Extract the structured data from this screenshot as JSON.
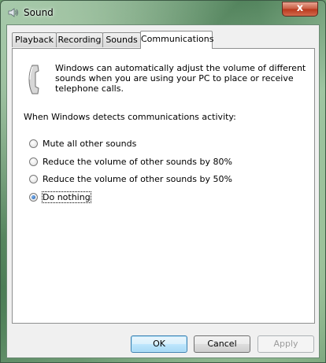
{
  "window": {
    "title": "Sound",
    "close_label": "x"
  },
  "tabs": [
    {
      "label": "Playback",
      "active": false
    },
    {
      "label": "Recording",
      "active": false
    },
    {
      "label": "Sounds",
      "active": false
    },
    {
      "label": "Communications",
      "active": true
    }
  ],
  "communications": {
    "intro": "Windows can automatically adjust the volume of different sounds when you are using your PC to place or receive telephone calls.",
    "detect_label": "When Windows detects communications activity:",
    "options": [
      {
        "label": "Mute all other sounds",
        "selected": false
      },
      {
        "label": "Reduce the volume of other sounds by 80%",
        "selected": false
      },
      {
        "label": "Reduce the volume of other sounds by 50%",
        "selected": false
      },
      {
        "label": "Do nothing",
        "selected": true
      }
    ]
  },
  "buttons": {
    "ok": "OK",
    "cancel": "Cancel",
    "apply": "Apply"
  }
}
